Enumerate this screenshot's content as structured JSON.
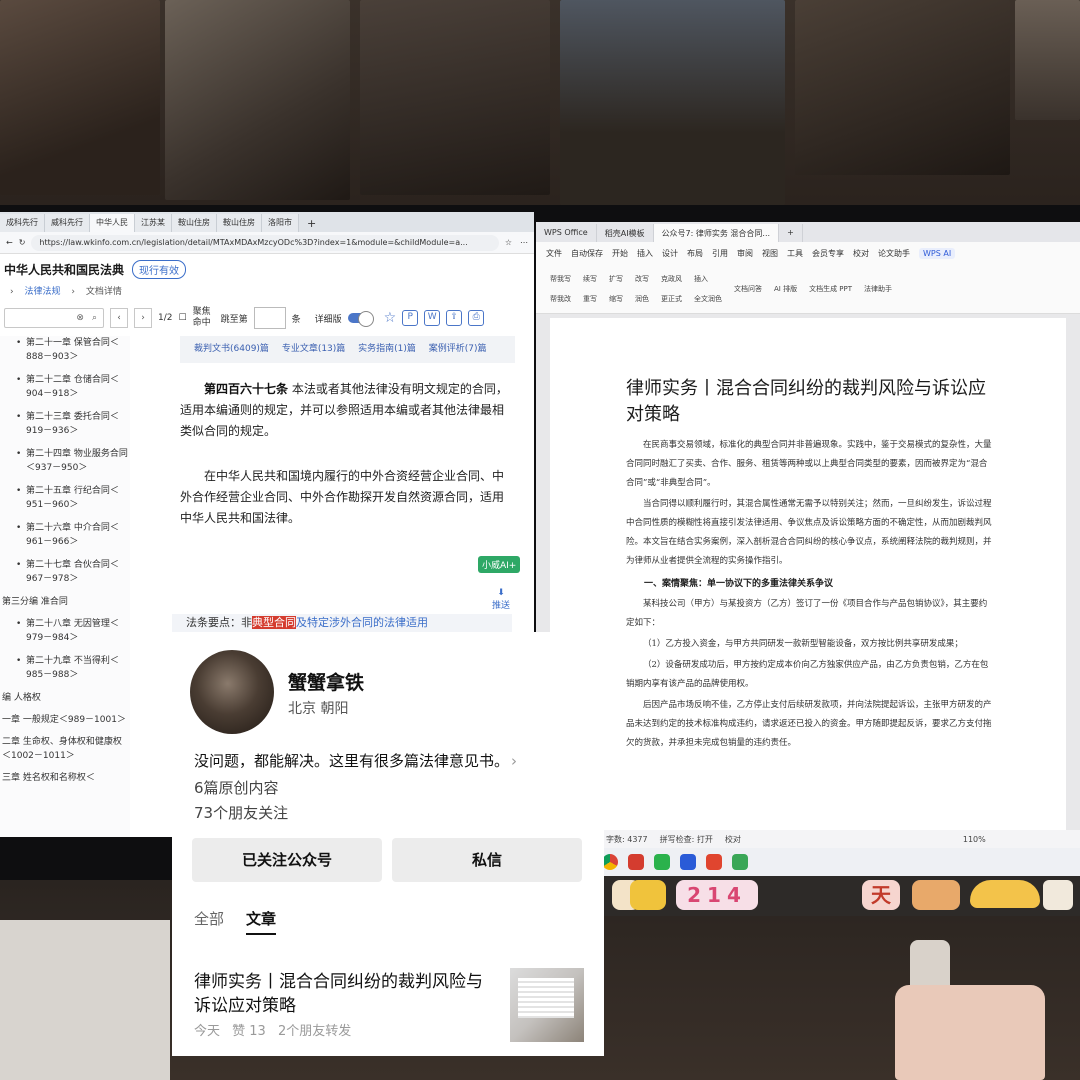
{
  "browser": {
    "tabs": [
      "成科先行",
      "威科先行",
      "中华人民",
      "江苏某",
      "鞍山住房",
      "鞍山住房",
      "洛阳市"
    ],
    "url": "https://law.wkinfo.com.cn/legislation/detail/MTAxMDAxMzcyODc%3D?index=1&module=&childModule=a...",
    "law_title": "中华人民共和国民法典",
    "status_badge": "现行有效",
    "crumbs": [
      "法律法规",
      "文档详情"
    ],
    "page_counter": "1/2",
    "focus_label": "聚焦命中",
    "jump_label": "跳至第",
    "jump_unit": "条",
    "detail_label": "详细版",
    "toc": [
      {
        "type": "item",
        "text": "第二十一章 保管合同＜888－903＞"
      },
      {
        "type": "item",
        "text": "第二十二章 仓储合同＜904－918＞"
      },
      {
        "type": "item",
        "text": "第二十三章 委托合同＜919－936＞"
      },
      {
        "type": "item",
        "text": "第二十四章 物业服务合同＜937－950＞"
      },
      {
        "type": "item",
        "text": "第二十五章 行纪合同＜951－960＞"
      },
      {
        "type": "item",
        "text": "第二十六章 中介合同＜961－966＞"
      },
      {
        "type": "item",
        "text": "第二十七章 合伙合同＜967－978＞"
      },
      {
        "type": "part",
        "text": "第三分编 准合同"
      },
      {
        "type": "item",
        "text": "第二十八章 无因管理＜979－984＞"
      },
      {
        "type": "item",
        "text": "第二十九章 不当得利＜985－988＞"
      },
      {
        "type": "part",
        "text": "编 人格权"
      },
      {
        "type": "part",
        "text": "一章 一般规定＜989－1001＞"
      },
      {
        "type": "part",
        "text": "二章 生命权、身体权和健康权＜1002－1011＞"
      },
      {
        "type": "part",
        "text": "三章 姓名权和名称权＜"
      }
    ],
    "refs": [
      "裁判文书(6409)篇",
      "专业文章(13)篇",
      "实务指南(1)篇",
      "案例评析(7)篇"
    ],
    "article_title": "第四百六十七条",
    "article_body": "本法或者其他法律没有明文规定的合同，适用本编通则的规定，并可以参照适用本编或者其他法律最相类似合同的规定。",
    "article_body2": "在中华人民共和国境内履行的中外合资经营企业合同、中外合作经营企业合同、中外合作勘探开发自然资源合同，适用中华人民共和国法律。",
    "ai_badge": "小威AI+",
    "push_label": "推送",
    "keypoint_prefix": "法条要点：非",
    "keypoint_highlight": "典型合同",
    "keypoint_rest": "及特定涉外合同的法律适用"
  },
  "wps": {
    "tabs": [
      "WPS Office",
      "稻壳AI模板",
      "公众号7: 律师实务 混合合同..."
    ],
    "menu": [
      "文件",
      "自动保存",
      "开始",
      "插入",
      "设计",
      "布局",
      "引用",
      "审阅",
      "视图",
      "工具",
      "会员专享",
      "校对",
      "论文助手",
      "WPS AI"
    ],
    "ribbon": [
      "帮我写",
      "续写",
      "扩写",
      "改写",
      "克政风",
      "插入",
      "帮我改",
      "重写",
      "缩写",
      "润色",
      "更正式",
      "全文润色",
      "文档问答",
      "AI 排版",
      "文档生成 PPT",
      "法律助手"
    ],
    "doc_title": "律师实务丨混合合同纠纷的裁判风险与诉讼应对策略",
    "paragraphs": [
      "在民商事交易领域，标准化的典型合同并非普遍现象。实践中，鉴于交易模式的复杂性，大量合同同时融汇了买卖、合作、服务、租赁等两种或以上典型合同类型的要素，因而被界定为“混合合同”或“非典型合同”。",
      "当合同得以顺利履行时，其混合属性通常无需予以特别关注；然而，一旦纠纷发生，诉讼过程中合同性质的模糊性将直接引发法律适用、争议焦点及诉讼策略方面的不确定性，从而加剧裁判风险。本文旨在结合实务案例，深入剖析混合合同纠纷的核心争议点，系统阐释法院的裁判规则，并为律师从业者提供全流程的实务操作指引。"
    ],
    "heading": "一、案情聚焦：单一协议下的多重法律关系争议",
    "paragraphs2": [
      "某科技公司（甲方）与某投资方（乙方）签订了一份《项目合作与产品包销协议》，其主要约定如下：",
      "（1）乙方投入资金，与甲方共同研发一款新型智能设备，双方按比例共享研发成果；",
      "（2）设备研发成功后，甲方按约定成本价向乙方独家供应产品，由乙方负责包销，乙方在包销期内享有该产品的品牌使用权。",
      "后因产品市场反响不佳，乙方停止支付后续研发款项，并向法院提起诉讼，主张甲方研发的产品未达到约定的技术标准构成违约，请求返还已投入的资金。甲方随即提起反诉，要求乙方支付拖欠的货款，并承担未完成包销量的违约责任。"
    ],
    "status": [
      "字数: 4377",
      "拼写检查: 打开",
      "校对",
      "110%"
    ]
  },
  "card": {
    "nickname": "蟹蟹拿铁",
    "location": "北京 朝阳",
    "bio": "没问题，都能解决。这里有很多篇法律意见书。",
    "original_count": "6篇原创内容",
    "followers": "73个朋友关注",
    "follow_button": "已关注公众号",
    "message_button": "私信",
    "tabs": [
      "全部",
      "文章"
    ],
    "article_title": "律师实务丨混合合同纠纷的裁判风险与诉讼应对策略",
    "article_meta": [
      "今天",
      "赞 13",
      "2个朋友转发"
    ]
  },
  "stickers": [
    "214",
    "天"
  ]
}
